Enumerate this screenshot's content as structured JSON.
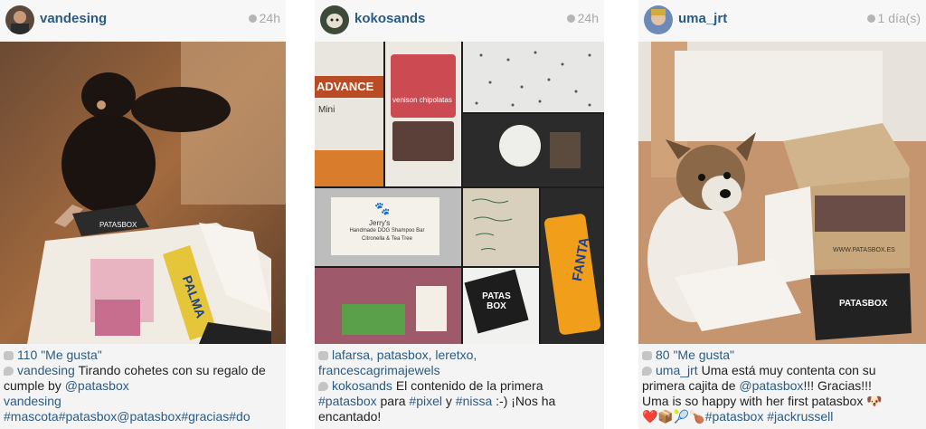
{
  "posts": [
    {
      "user": "vandesing",
      "time": "24h",
      "likes": "110 \"Me gusta\"",
      "caption_user": "vandesing",
      "caption_text_1": " Tirando cohetes con su regalo de",
      "caption_text_2": "cumple by ",
      "caption_mention": "@patasbox",
      "comment_user": "vandesing",
      "comment_text": "#mascota#patasbox@patasbox#gracias#do",
      "box_text": "PATASBOX",
      "can_text": "PALMA"
    },
    {
      "user": "kokosands",
      "time": "24h",
      "likers_1": "lafarsa, patasbox, leretxo,",
      "likers_2": "francescagrimajewels",
      "caption_user": "kokosands",
      "caption_text_1": " El contenido de la primera",
      "caption_tag_1": "#patasbox",
      "caption_text_2": " para ",
      "caption_tag_2": "#pixel",
      "caption_text_3": " y ",
      "caption_tag_3": "#nissa",
      "caption_text_4": " :-) ¡Nos ha",
      "caption_text_5": "encantado!",
      "food_brand": "ADVANCE",
      "food_mini": "Mini",
      "treat_text": "venison chipolatas",
      "soap_text": "Jerry's",
      "soap_sub": "Handmade DOG Shampoo Bar",
      "soap_sub2": "Citronella & Tea Tree",
      "card_text": "Patasbox",
      "brand_box": "PATAS BOX"
    },
    {
      "user": "uma_jrt",
      "time": "1 día(s)",
      "likes": "80 \"Me gusta\"",
      "caption_user": "uma_jrt",
      "caption_text_1": " Uma está muy contenta con su",
      "caption_text_2": "primera cajita de ",
      "caption_mention": "@patasbox",
      "caption_text_3": "!!! Gracias!!!",
      "caption_text_4": "Uma is so happy with her first patasbox 🐶",
      "comment_emoji": "❤️📦🎾🍗",
      "comment_tag_1": "#patasbox",
      "comment_tag_2": "#jackrussell",
      "box_text": "PATASBOX",
      "box_url": "WWW.PATASBOX.ES"
    }
  ]
}
